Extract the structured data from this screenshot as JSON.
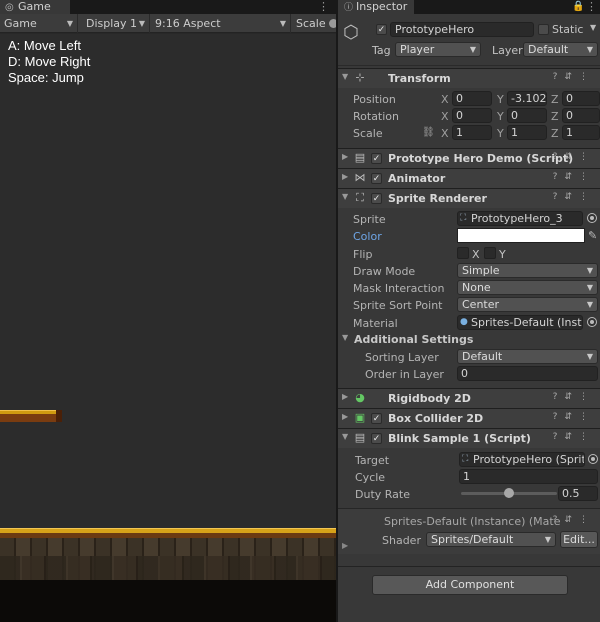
{
  "game": {
    "tab_label": "Game",
    "toolbar": {
      "view_mode": "Game",
      "display": "Display 1",
      "aspect": "9:16 Aspect",
      "scale_label": "Scale"
    },
    "instructions": [
      "A: Move Left",
      "D: Move Right",
      "Space: Jump"
    ]
  },
  "inspector": {
    "tab_label": "Inspector",
    "object_name": "PrototypeHero",
    "static_label": "Static",
    "tag_label": "Tag",
    "tag_value": "Player",
    "layer_label": "Layer",
    "layer_value": "Default",
    "transform": {
      "title": "Transform",
      "position_label": "Position",
      "rotation_label": "Rotation",
      "scale_label": "Scale",
      "axes": [
        "X",
        "Y",
        "Z"
      ],
      "position": [
        "0",
        "-3.102",
        "0"
      ],
      "rotation": [
        "0",
        "0",
        "0"
      ],
      "scale": [
        "1",
        "1",
        "1"
      ]
    },
    "components": {
      "demo_script": "Prototype Hero Demo (Script)",
      "animator": "Animator",
      "sprite_renderer": "Sprite Renderer",
      "rigidbody": "Rigidbody 2D",
      "box_collider": "Box Collider 2D",
      "blink_script": "Blink Sample 1 (Script)"
    },
    "sprite_renderer": {
      "sprite_label": "Sprite",
      "sprite_value": "PrototypeHero_3",
      "color_label": "Color",
      "color_value": "#ffffff",
      "flip_label": "Flip",
      "flip_x": "X",
      "flip_y": "Y",
      "draw_mode_label": "Draw Mode",
      "draw_mode_value": "Simple",
      "mask_label": "Mask Interaction",
      "mask_value": "None",
      "sort_point_label": "Sprite Sort Point",
      "sort_point_value": "Center",
      "material_label": "Material",
      "material_value": "Sprites-Default (Instan",
      "additional_settings": "Additional Settings",
      "sorting_layer_label": "Sorting Layer",
      "sorting_layer_value": "Default",
      "order_label": "Order in Layer",
      "order_value": "0"
    },
    "blink": {
      "target_label": "Target",
      "target_value": "PrototypeHero (Sprite R",
      "cycle_label": "Cycle",
      "cycle_value": "1",
      "duty_label": "Duty Rate",
      "duty_value": "0.5",
      "duty_fraction": 0.5
    },
    "material": {
      "title": "Sprites-Default (Instance) (Mate",
      "shader_label": "Shader",
      "shader_value": "Sprites/Default",
      "edit_label": "Edit..."
    },
    "add_component": "Add Component"
  }
}
